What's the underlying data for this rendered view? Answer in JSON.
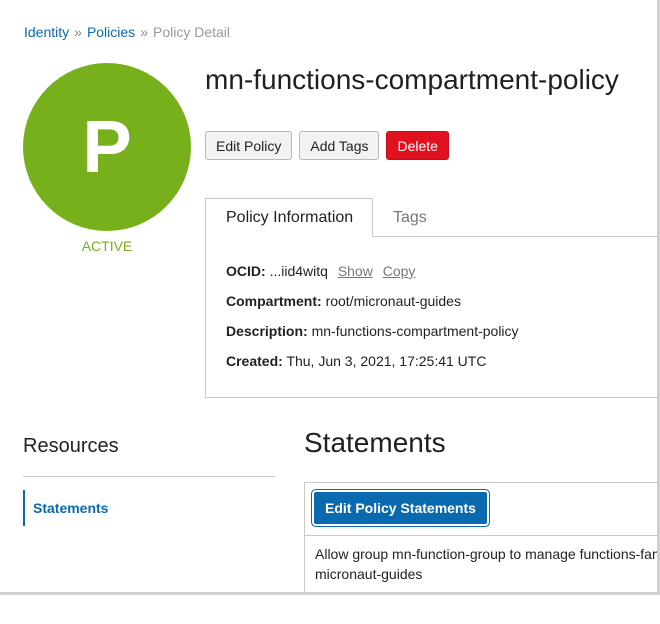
{
  "breadcrumb": {
    "items": [
      "Identity",
      "Policies"
    ],
    "separator": "»",
    "current": "Policy Detail"
  },
  "avatar": {
    "letter": "P",
    "status": "ACTIVE",
    "color": "#78b01c"
  },
  "policy": {
    "name": "mn-functions-compartment-policy"
  },
  "actions": {
    "edit": "Edit Policy",
    "add_tags": "Add Tags",
    "delete": "Delete"
  },
  "tabs": {
    "info": "Policy Information",
    "tags": "Tags"
  },
  "info": {
    "ocid_label": "OCID:",
    "ocid_value": "...iid4witq",
    "show": "Show",
    "copy": "Copy",
    "compartment_label": "Compartment:",
    "compartment_value": "root/micronaut-guides",
    "description_label": "Description:",
    "description_value": "mn-functions-compartment-policy",
    "created_label": "Created:",
    "created_value": "Thu, Jun 3, 2021, 17:25:41 UTC"
  },
  "resources": {
    "title": "Resources",
    "items": [
      "Statements"
    ]
  },
  "statements": {
    "title": "Statements",
    "edit_button": "Edit Policy Statements",
    "line1": "Allow group mn-function-group to manage functions-fam",
    "line2": "micronaut-guides"
  },
  "colors": {
    "link": "#0a6ab0",
    "danger": "#e0121f",
    "active": "#78b01c"
  }
}
